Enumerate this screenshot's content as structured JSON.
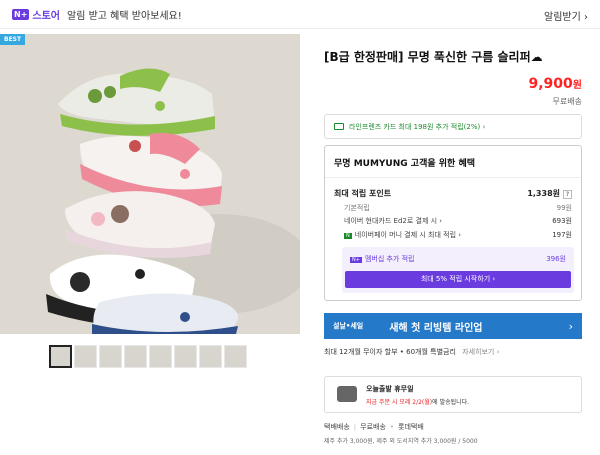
{
  "topbar": {
    "badge": "N+",
    "store": "스토어",
    "alert_text": "알림 받고 혜택 받아보세요!",
    "alert_button": "알림받기 ›"
  },
  "gallery": {
    "badge": "BEST",
    "thumbnail_count": 8
  },
  "product": {
    "title": "[B급 한정판매] 무명 푹신한 구름 슬리퍼☁",
    "price": "9,900",
    "price_unit": "원",
    "shipping_tag": "무료배송"
  },
  "card_benefit": {
    "text": "라인프렌즈 카드 최대 198원 추가 적립(2%) ›"
  },
  "benefits": {
    "title": "무명 MUMYUNG 고객을 위한 혜택",
    "max_points_label": "최대 적립 포인트",
    "max_points_value": "1,338원",
    "rows": [
      {
        "label": "기본적립",
        "value": "99원"
      },
      {
        "label": "네이버 현대카드 Ed2로 결제 시 ›",
        "value": "693원"
      },
      {
        "label": "네이버페이 머니 결제 시 최대 적립 ›",
        "value": "197원"
      }
    ],
    "member_label": "멤버십 추가 적립",
    "member_value": "396원",
    "member_cta": "최대 5% 적립 시작하기 ›"
  },
  "promo": {
    "tag": "설날•세일",
    "text": "새해 첫 리빙템 라인업",
    "arrow": "›"
  },
  "installment": {
    "text": "최대 12개월 무이자 할부 • 60개월 특별금리",
    "more": "자세히보기 ›"
  },
  "delivery": {
    "title": "오늘출발 휴무일",
    "sub_red": "지금 주문 시 모레 2/2(월)",
    "sub_rest": "에 발송됩니다."
  },
  "shipping": {
    "type": "택배배송",
    "fee": "무료배송",
    "carrier": "롯데택배",
    "note": "제주 추가 3,000원, 제주 외 도서지역 추가 3,000원 / 5000"
  }
}
